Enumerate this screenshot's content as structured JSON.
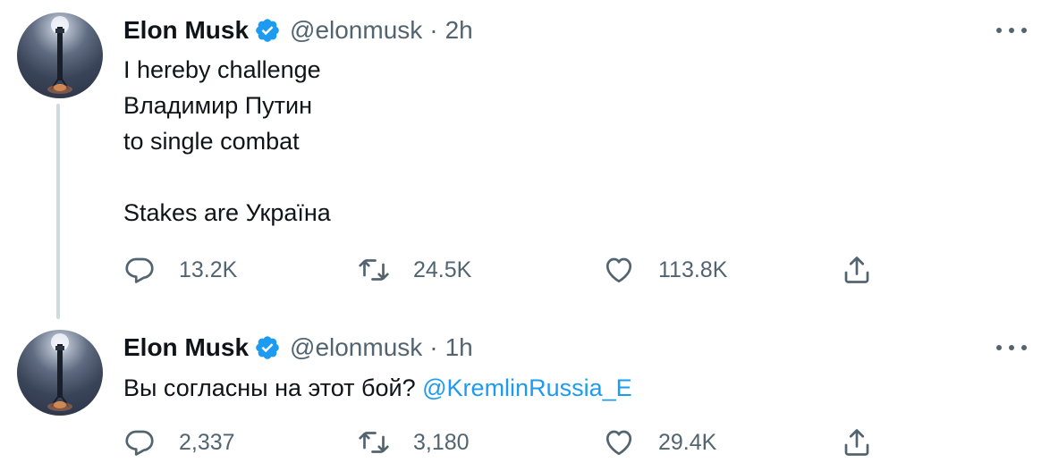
{
  "tweets": [
    {
      "author": {
        "name": "Elon Musk",
        "handle": "@elonmusk",
        "verified": true
      },
      "separator": "·",
      "time": "2h",
      "lines": [
        "I hereby challenge",
        "Владимир Путин",
        "to single combat",
        "",
        "Stakes are Україна"
      ],
      "stats": {
        "replies": "13.2K",
        "retweets": "24.5K",
        "likes": "113.8K"
      }
    },
    {
      "author": {
        "name": "Elon Musk",
        "handle": "@elonmusk",
        "verified": true
      },
      "separator": "·",
      "time": "1h",
      "text": "Вы согласны на этот бой?",
      "mention": "@KremlinRussia_E",
      "stats": {
        "replies": "2,337",
        "retweets": "3,180",
        "likes": "29.4K"
      }
    }
  ],
  "icons": [
    "more-icon",
    "verified-badge-icon",
    "reply-icon",
    "retweet-icon",
    "like-icon",
    "share-icon",
    "avatar-image"
  ],
  "colors": {
    "text": "#0f1419",
    "secondary": "#536471",
    "link": "#1d9bf0",
    "thread": "#cfd9de",
    "verified": "#1d9bf0"
  }
}
